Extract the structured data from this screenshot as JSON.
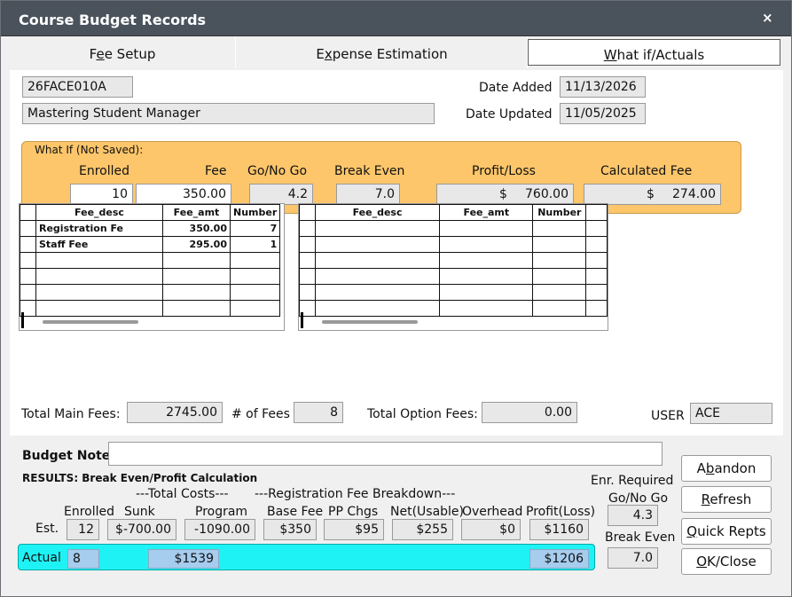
{
  "window": {
    "title": "Course Budget Records",
    "close": "×"
  },
  "tabs": [
    {
      "pre": "F",
      "key": "e",
      "post": "e Setup"
    },
    {
      "pre": "E",
      "key": "x",
      "post": "pense Estimation"
    },
    {
      "pre": "",
      "key": "W",
      "post": "hat if/Actuals"
    }
  ],
  "course": {
    "code": "26FACE010A",
    "name": "Mastering Student Manager"
  },
  "dates": {
    "added_label": "Date Added",
    "added": "11/13/2026",
    "updated_label": "Date Updated",
    "updated": "11/05/2025"
  },
  "whatif": {
    "title": "What If (Not Saved):",
    "labels": {
      "enrolled": "Enrolled",
      "fee": "Fee",
      "gonogo": "Go/No Go",
      "breakeven": "Break Even",
      "profit": "Profit/Loss",
      "calcfee": "Calculated Fee"
    },
    "values": {
      "enrolled": "10",
      "fee": "350.00",
      "gonogo": "4.2",
      "breakeven": "7.0",
      "profit_cur": "$",
      "profit": "760.00",
      "calcfee_cur": "$",
      "calcfee": "274.00"
    }
  },
  "main_grid": {
    "headers": [
      "Fee_desc",
      "Fee_amt",
      "Number"
    ],
    "rows": [
      {
        "desc": "Registration Fe",
        "amt": "350.00",
        "num": "7"
      },
      {
        "desc": "Staff Fee",
        "amt": "295.00",
        "num": "1"
      }
    ]
  },
  "option_grid": {
    "headers": [
      "Fee_desc",
      "Fee_amt",
      "Number"
    ]
  },
  "totals": {
    "main_label": "Total Main Fees:",
    "main": "2745.00",
    "count_label": "# of Fees",
    "count": "8",
    "option_label": "Total Option Fees:",
    "option": "0.00",
    "user_label": "USER",
    "user": "ACE"
  },
  "budget_note_label": "Budget Note:",
  "results": {
    "title": "RESULTS: Break Even/Profit Calculation",
    "total_costs_header": "---Total Costs---",
    "reg_breakdown_header": "---Registration Fee Breakdown---",
    "cols": {
      "enrolled": "Enrolled",
      "sunk": "Sunk",
      "program": "Program",
      "base": "Base Fee",
      "pp": "PP Chgs",
      "net": "Net(Usable)",
      "overhead": "Overhead",
      "profit": "Profit(Loss)"
    },
    "est_label": "Est.",
    "est": {
      "enrolled": "12",
      "sunk": "$-700.00",
      "program": "-1090.00",
      "base": "$350",
      "pp": "$95",
      "net": "$255",
      "overhead": "$0",
      "profit": "$1160"
    },
    "actual_label": "Actual",
    "actual": {
      "enrolled": "8",
      "costs": "$1539",
      "profit": "$1206"
    },
    "enr_required_label": "Enr. Required",
    "gonogo_label": "Go/No Go",
    "gonogo": "4.3",
    "breakeven_label": "Break Even",
    "breakeven": "7.0"
  },
  "buttons": {
    "abandon": {
      "pre": "A",
      "key": "b",
      "post": "andon"
    },
    "refresh": {
      "pre": "",
      "key": "R",
      "post": "efresh"
    },
    "quick": {
      "pre": "",
      "key": "Q",
      "post": "uick Repts"
    },
    "ok": {
      "pre": "",
      "key": "O",
      "post": "K/Close"
    }
  }
}
